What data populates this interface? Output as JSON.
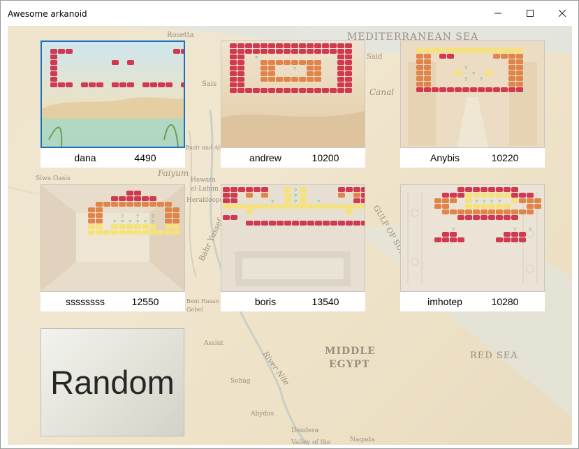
{
  "window": {
    "title": "Awesome arkanoid",
    "controls": {
      "minimize": "minimize-icon",
      "maximize": "maximize-icon",
      "close": "close-icon"
    }
  },
  "map_labels": [
    {
      "text": "MEDITERRANEAN SEA"
    },
    {
      "text": "Rosetta"
    },
    {
      "text": "Said"
    },
    {
      "text": "Canal"
    },
    {
      "text": "Sais"
    },
    {
      "text": "Busir and Abusir"
    },
    {
      "text": "Faiyum"
    },
    {
      "text": "Siwa Oasis"
    },
    {
      "text": "Hawara"
    },
    {
      "text": "el-Lahun"
    },
    {
      "text": "Herakleopolis"
    },
    {
      "text": "Bahr Yussef"
    },
    {
      "text": "GULF OF SUEZ"
    },
    {
      "text": "MIDDLE"
    },
    {
      "text": "EGYPT"
    },
    {
      "text": "RED SEA"
    },
    {
      "text": "Assiut"
    },
    {
      "text": "River Nile"
    },
    {
      "text": "Sohag"
    },
    {
      "text": "Abydos"
    },
    {
      "text": "Dendera"
    },
    {
      "text": "Naqada"
    },
    {
      "text": "Valley of the"
    },
    {
      "text": "Beni Hasan"
    },
    {
      "text": "Gebel"
    }
  ],
  "levels": [
    {
      "player": "dana",
      "score": "4490",
      "selected": true,
      "theme": "oasis"
    },
    {
      "player": "andrew",
      "score": "10200",
      "selected": false,
      "theme": "desert"
    },
    {
      "player": "Anybis",
      "score": "10220",
      "selected": false,
      "theme": "temple"
    },
    {
      "player": "ssssssss",
      "score": "12550",
      "selected": false,
      "theme": "tomb"
    },
    {
      "player": "boris",
      "score": "13540",
      "selected": false,
      "theme": "sarcophagus"
    },
    {
      "player": "imhotep",
      "score": "10280",
      "selected": false,
      "theme": "hieroglyph"
    }
  ],
  "random_button": {
    "label": "Random"
  },
  "colors": {
    "brick_red": "#d0394f",
    "brick_orange": "#e0844a",
    "brick_yellow": "#f6e27a",
    "bonus_green": "#3fbf6a",
    "selection": "#1e6fbd"
  }
}
